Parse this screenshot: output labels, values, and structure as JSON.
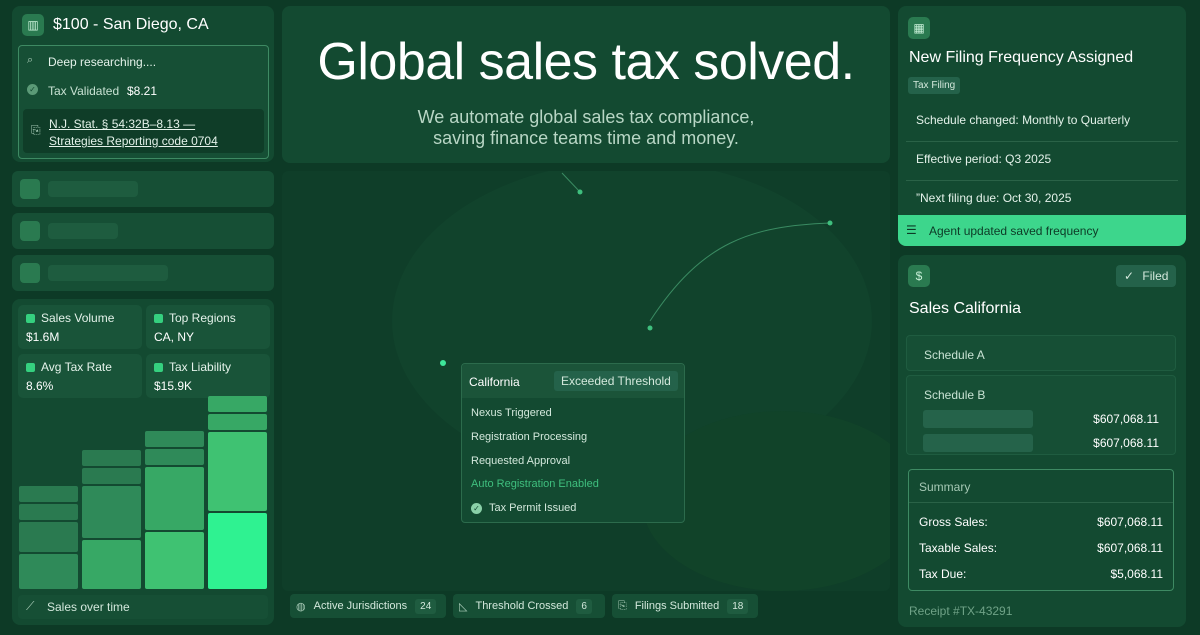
{
  "search_card": {
    "title": "$100 - San Diego, CA",
    "researching": "Deep researching....",
    "validated_label": "Tax Validated",
    "validated_amount": "$8.21",
    "citation_line1": "N.J. Stat. § 54:32B–8.13 —",
    "citation_line2": "Strategies Reporting code 0704"
  },
  "metrics": [
    {
      "label": "Sales Volume",
      "value": "$1.6M"
    },
    {
      "label": "Top Regions",
      "value": "CA, NY"
    },
    {
      "label": "Avg Tax Rate",
      "value": "8.6%"
    },
    {
      "label": "Tax Liability",
      "value": "$15.9K"
    }
  ],
  "sales_chart": {
    "type": "bar",
    "label": "Sales over time",
    "columns": [
      {
        "segments": [
          0.12,
          0.12,
          0.22,
          0.26
        ],
        "color_levels": [
          1,
          1,
          1,
          2
        ]
      },
      {
        "segments": [
          0.12,
          0.12,
          0.38,
          0.36
        ],
        "color_levels": [
          1,
          1,
          2,
          3
        ]
      },
      {
        "segments": [
          0.12,
          0.12,
          0.46,
          0.42
        ],
        "color_levels": [
          2,
          2,
          3,
          4
        ]
      },
      {
        "segments": [
          0.12,
          0.12,
          0.58,
          0.56
        ],
        "color_levels": [
          3,
          3,
          4,
          5
        ]
      }
    ]
  },
  "hero": {
    "title": "Global sales tax solved.",
    "subtitle_line1": "We automate global sales tax compliance,",
    "subtitle_line2": "saving finance teams time and money."
  },
  "california_popup": {
    "state": "California",
    "badge": "Exceeded Threshold",
    "steps": [
      "Nexus Triggered",
      "Registration Processing",
      "Requested Approval",
      "Auto Registration Enabled",
      "Tax Permit Issued"
    ]
  },
  "bottom_stats": [
    {
      "label": "Active Jurisdictions",
      "count": "24"
    },
    {
      "label": "Threshold Crossed",
      "count": "6"
    },
    {
      "label": "Filings Submitted",
      "count": "18"
    }
  ],
  "filing_card": {
    "title": "New Filing Frequency Assigned",
    "tag": "Tax Filing",
    "lines": [
      "Schedule changed: Monthly to Quarterly",
      "Effective period: Q3 2025",
      "”Next filing due: Oct 30, 2025"
    ],
    "agent_status": "Agent updated saved frequency"
  },
  "sales_card": {
    "filed_label": "Filed",
    "title": "Sales California",
    "schedule_a": "Schedule A",
    "schedule_b": "Schedule B",
    "schedule_b_amounts": [
      "$607,068.11",
      "$607,068.11"
    ],
    "summary_title": "Summary",
    "summary_rows": [
      {
        "label": "Gross Sales:",
        "value": "$607,068.11"
      },
      {
        "label": "Taxable Sales:",
        "value": "$607,068.11"
      },
      {
        "label": "Tax Due:",
        "value": "$5,068.11"
      }
    ],
    "receipt": "Receipt #TX-43291"
  },
  "colors": {
    "background": "#0d3a26",
    "card": "#134a31",
    "accent": "#35d07f",
    "agent_banner": "#3dd68c"
  }
}
